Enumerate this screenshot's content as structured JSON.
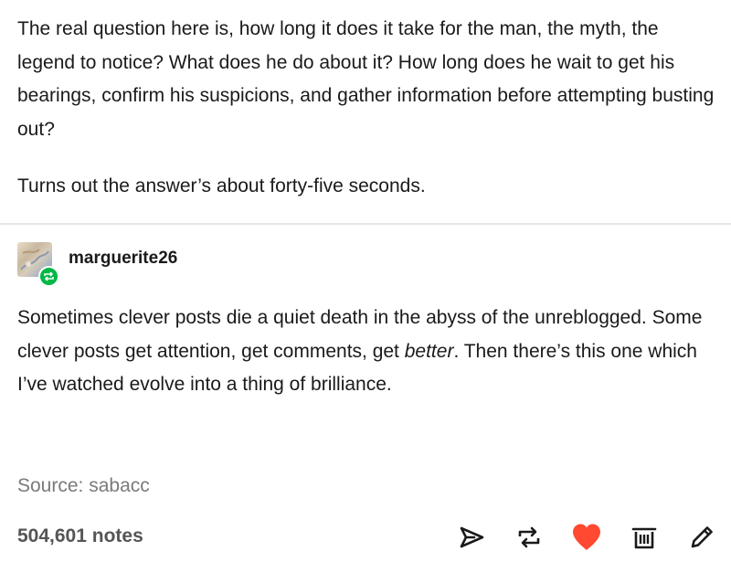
{
  "post": {
    "paragraph1": "The real question here is, how long it does it take for the man, the myth, the legend to notice? What does he do about it? How long does he wait to get his bearings, confirm his suspicions, and gather information before attempting busting out?",
    "paragraph2": "Turns out the answer’s about forty-five seconds.",
    "reblog": {
      "username": "marguerite26",
      "text_part1": "Sometimes clever posts die a quiet death in the abyss of the unreblogged. Some clever posts get attention, get comments, get ",
      "text_italic": "better",
      "text_part2": ". Then there’s this one which I’ve watched evolve into a thing of brilliance."
    },
    "source": {
      "label": "Source: ",
      "name": "sabacc"
    },
    "notes": "504,601 notes"
  },
  "icons": {
    "share": "paper-plane-icon",
    "reblog": "reblog-icon",
    "like": "heart-icon",
    "delete": "trash-icon",
    "edit": "pencil-icon"
  },
  "colors": {
    "like": "#ff4930",
    "reblog_badge": "#00b845",
    "icon": "#1a1a1a",
    "muted": "#7a7a7a"
  }
}
